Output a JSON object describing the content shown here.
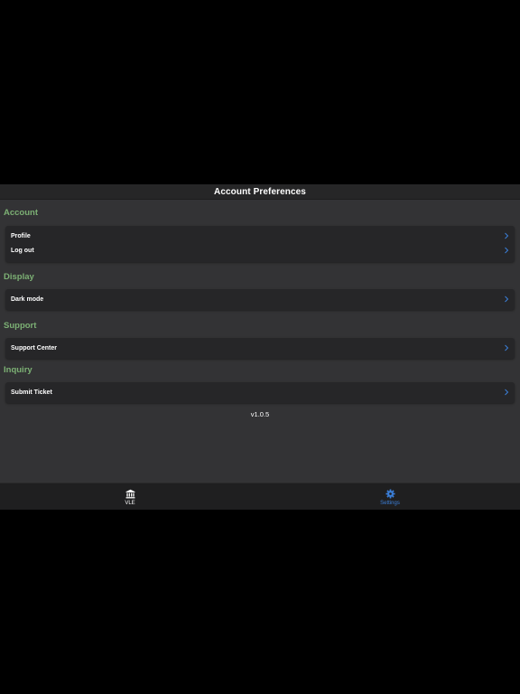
{
  "header": {
    "title": "Account Preferences"
  },
  "sections": {
    "account": {
      "title": "Account",
      "items": [
        {
          "label": "Profile"
        },
        {
          "label": "Log out"
        }
      ]
    },
    "display": {
      "title": "Display",
      "items": [
        {
          "label": "Dark mode"
        }
      ]
    },
    "support": {
      "title": "Support",
      "items": [
        {
          "label": "Support Center"
        }
      ]
    },
    "inquiry": {
      "title": "Inquiry",
      "items": [
        {
          "label": "Submit Ticket"
        }
      ]
    }
  },
  "version": "v1.0.5",
  "tabbar": {
    "tabs": [
      {
        "label": "VLE",
        "icon": "bank-icon",
        "active": false,
        "color": "#ffffff"
      },
      {
        "label": "Settings",
        "icon": "gear-icon",
        "active": true,
        "color": "#3b7fd9"
      }
    ]
  },
  "colors": {
    "section_title": "#7cb074",
    "background": "#333335",
    "card": "#262628",
    "active_tab": "#3b7fd9"
  }
}
